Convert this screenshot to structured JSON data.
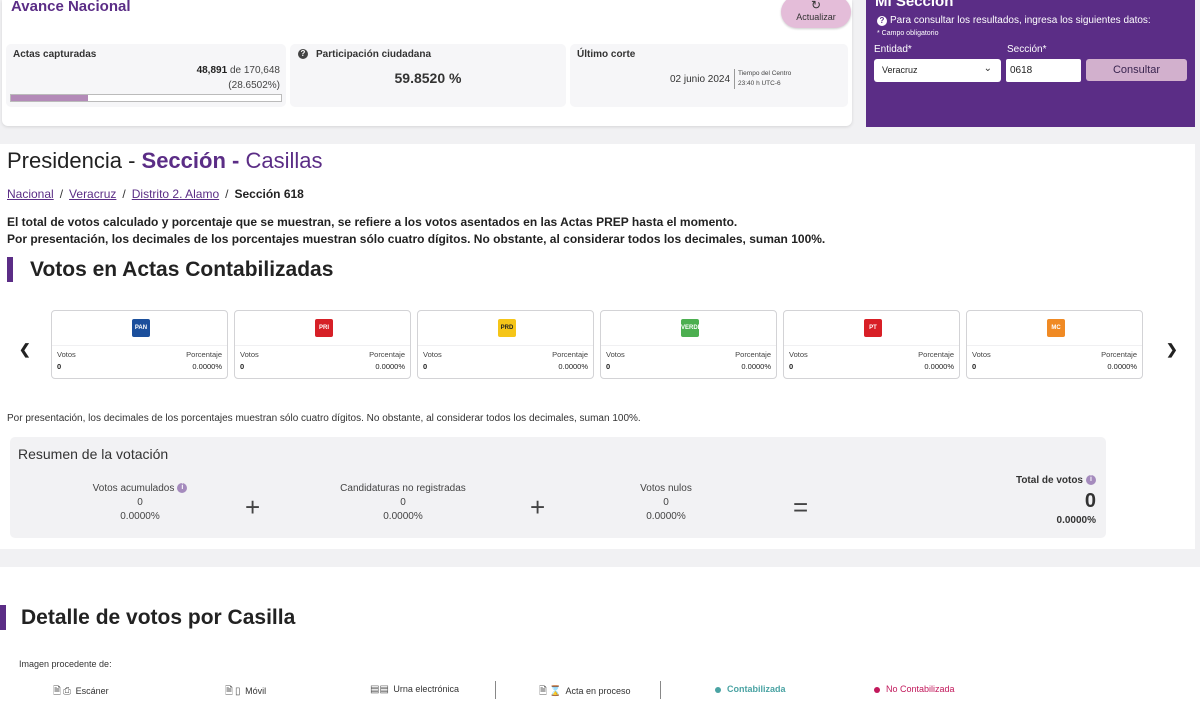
{
  "header": {
    "title": "Avance Nacional",
    "refresh_label": "Actualizar",
    "actas": {
      "title": "Actas capturadas",
      "captured": "48,891",
      "of_word": "de",
      "total": "170,648",
      "percent": "(28.6502%)",
      "progress_fraction": 0.286502
    },
    "participacion": {
      "title": "Participación ciudadana",
      "value": "59.8520 %"
    },
    "corte": {
      "title": "Último corte",
      "date": "02 junio 2024",
      "tz_line1": "Tiempo del Centro",
      "tz_line2": "23:40 h UTC-6"
    }
  },
  "mi_seccion": {
    "title": "Mi Sección",
    "info": "Para consultar los resultados, ingresa los siguientes datos:",
    "required_note": "* Campo obligatorio",
    "entidad_label": "Entidad*",
    "entidad_value": "Veracruz",
    "seccion_label": "Sección*",
    "seccion_value": "0618",
    "button": "Consultar"
  },
  "page": {
    "title_part1": "Presidencia -",
    "title_part2": "Sección -",
    "title_part3": "Casillas",
    "breadcrumb": [
      "Nacional",
      "Veracruz",
      "Distrito 2. Alamo",
      "Sección 618"
    ],
    "notice_line1": "El total de votos calculado y porcentaje que se muestran, se refiere a los votos asentados en las Actas PREP hasta el momento.",
    "notice_line2": "Por presentación, los decimales de los porcentajes muestran sólo cuatro dígitos. No obstante, al considerar todos los decimales, suman 100%.",
    "section_title": "Votos en Actas Contabilizadas",
    "footnote": "Por presentación, los decimales de los porcentajes muestran sólo cuatro dígitos. No obstante, al considerar todos los decimales, suman 100%."
  },
  "parties": [
    {
      "logo": "PAN",
      "color": "#1b4f9c",
      "votes_label": "Votos",
      "votes": "0",
      "pct_label": "Porcentaje",
      "pct": "0.0000%"
    },
    {
      "logo": "PRI",
      "color": "#d62027",
      "votes_label": "Votos",
      "votes": "0",
      "pct_label": "Porcentaje",
      "pct": "0.0000%"
    },
    {
      "logo": "PRD",
      "color": "#f5c518",
      "votes_label": "Votos",
      "votes": "0",
      "pct_label": "Porcentaje",
      "pct": "0.0000%"
    },
    {
      "logo": "VERDE",
      "color": "#4caf50",
      "votes_label": "Votos",
      "votes": "0",
      "pct_label": "Porcentaje",
      "pct": "0.0000%"
    },
    {
      "logo": "PT",
      "color": "#d81f26",
      "votes_label": "Votos",
      "votes": "0",
      "pct_label": "Porcentaje",
      "pct": "0.0000%"
    },
    {
      "logo": "MC",
      "color": "#f08a24",
      "votes_label": "Votos",
      "votes": "0",
      "pct_label": "Porcentaje",
      "pct": "0.0000%"
    }
  ],
  "resumen": {
    "title": "Resumen de la votación",
    "acumulados": {
      "label": "Votos acumulados",
      "value": "0",
      "pct": "0.0000%"
    },
    "no_registradas": {
      "label": "Candidaturas no registradas",
      "value": "0",
      "pct": "0.0000%"
    },
    "nulos": {
      "label": "Votos nulos",
      "value": "0",
      "pct": "0.0000%"
    },
    "total": {
      "label": "Total de votos",
      "value": "0",
      "pct": "0.0000%"
    }
  },
  "detalle": {
    "title": "Detalle de votos por Casilla",
    "image_source_label": "Imagen procedente de:",
    "legend": {
      "escaner": "Escáner",
      "movil": "Móvil",
      "urna": "Urna electrónica",
      "proceso": "Acta en proceso",
      "contabilizada": "Contabilizada",
      "no_contabilizada": "No Contabilizada"
    },
    "colors": {
      "contabilizada": "#4aa3a3",
      "no_contabilizada": "#c2185b"
    }
  }
}
